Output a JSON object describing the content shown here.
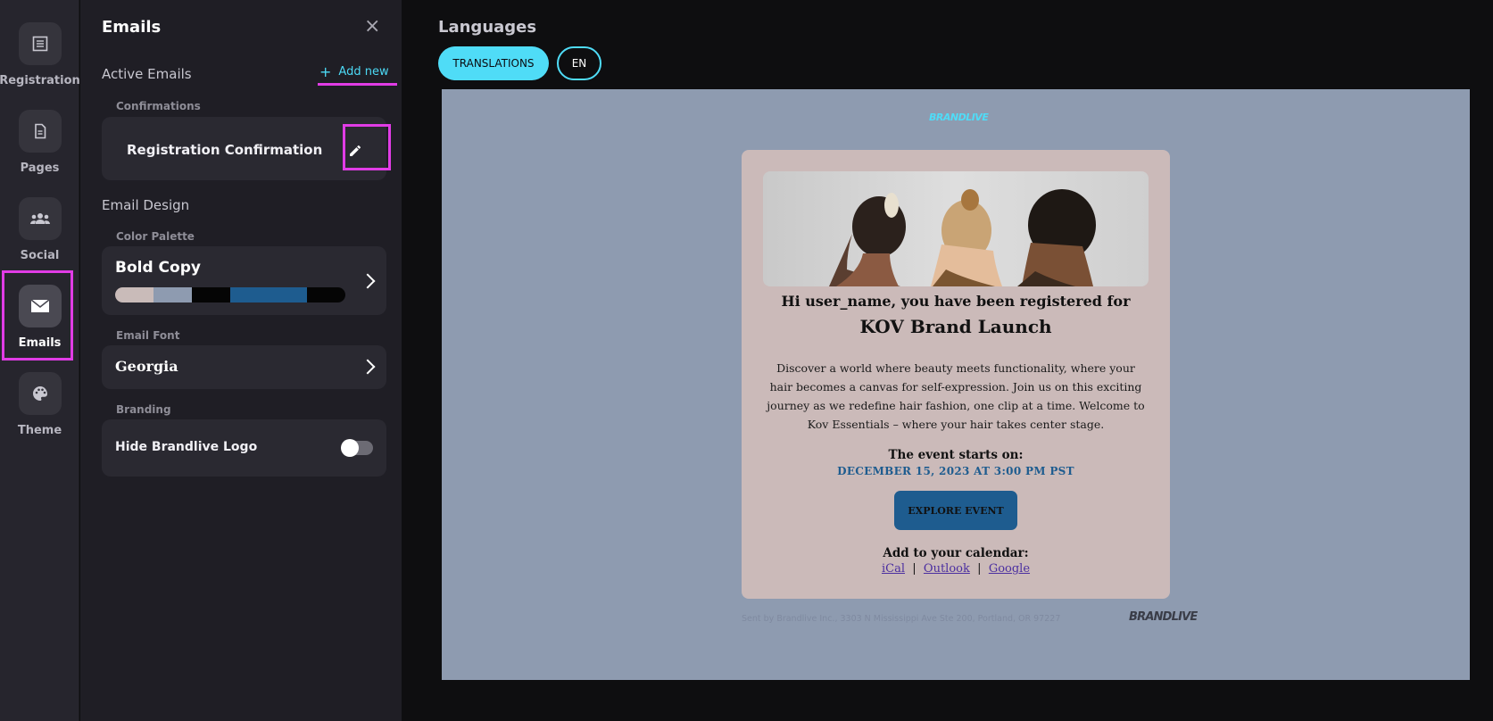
{
  "rail": {
    "items": [
      {
        "label": "Registration",
        "icon": "list-icon"
      },
      {
        "label": "Pages",
        "icon": "document-icon"
      },
      {
        "label": "Social",
        "icon": "people-icon"
      },
      {
        "label": "Emails",
        "icon": "envelope-icon",
        "active": true
      },
      {
        "label": "Theme",
        "icon": "palette-icon"
      }
    ]
  },
  "panel": {
    "title": "Emails",
    "active_emails_label": "Active Emails",
    "add_new_label": "Add new",
    "confirmations_label": "Confirmations",
    "registration_confirmation_label": "Registration Confirmation",
    "email_design_label": "Email Design",
    "color_palette_label": "Color Palette",
    "palette_name": "Bold Copy",
    "palette_colors": [
      "#c9bbb9",
      "#8e9bb0",
      "#050505",
      "#1e5c8f",
      "#050505"
    ],
    "email_font_label": "Email Font",
    "font_name": "Georgia",
    "branding_label": "Branding",
    "hide_logo_label": "Hide Brandlive Logo",
    "hide_logo_enabled": false
  },
  "main": {
    "languages_title": "Languages",
    "translations_label": "TRANSLATIONS",
    "lang_label": "EN"
  },
  "email": {
    "brand_top": "BRANDLIVE",
    "greeting": "Hi user_name, you have been registered for",
    "event_name": "KOV Brand Launch",
    "body": "Discover a world where beauty meets functionality, where your hair becomes a canvas for self-expression. Join us on this exciting journey as we redefine hair fashion, one clip at a time. Welcome to Kov Essentials – where your hair takes center stage.",
    "starts_label": "The event starts on:",
    "date": "DECEMBER 15, 2023 AT 3:00 PM PST",
    "cta": "EXPLORE EVENT",
    "calendar_label": "Add to your calendar:",
    "cal_ical": "iCal",
    "cal_outlook": "Outlook",
    "cal_google": "Google",
    "footer": "Sent by Brandlive Inc., 3303 N Mississippi Ave Ste 200, Portland, OR 97227",
    "brand_foot": "BRANDLIVE"
  },
  "colors": {
    "accent": "#4fdcf7",
    "highlight": "#e13ce6",
    "preview_bg": "#8e9bb0",
    "card_bg": "#cbbab9"
  }
}
